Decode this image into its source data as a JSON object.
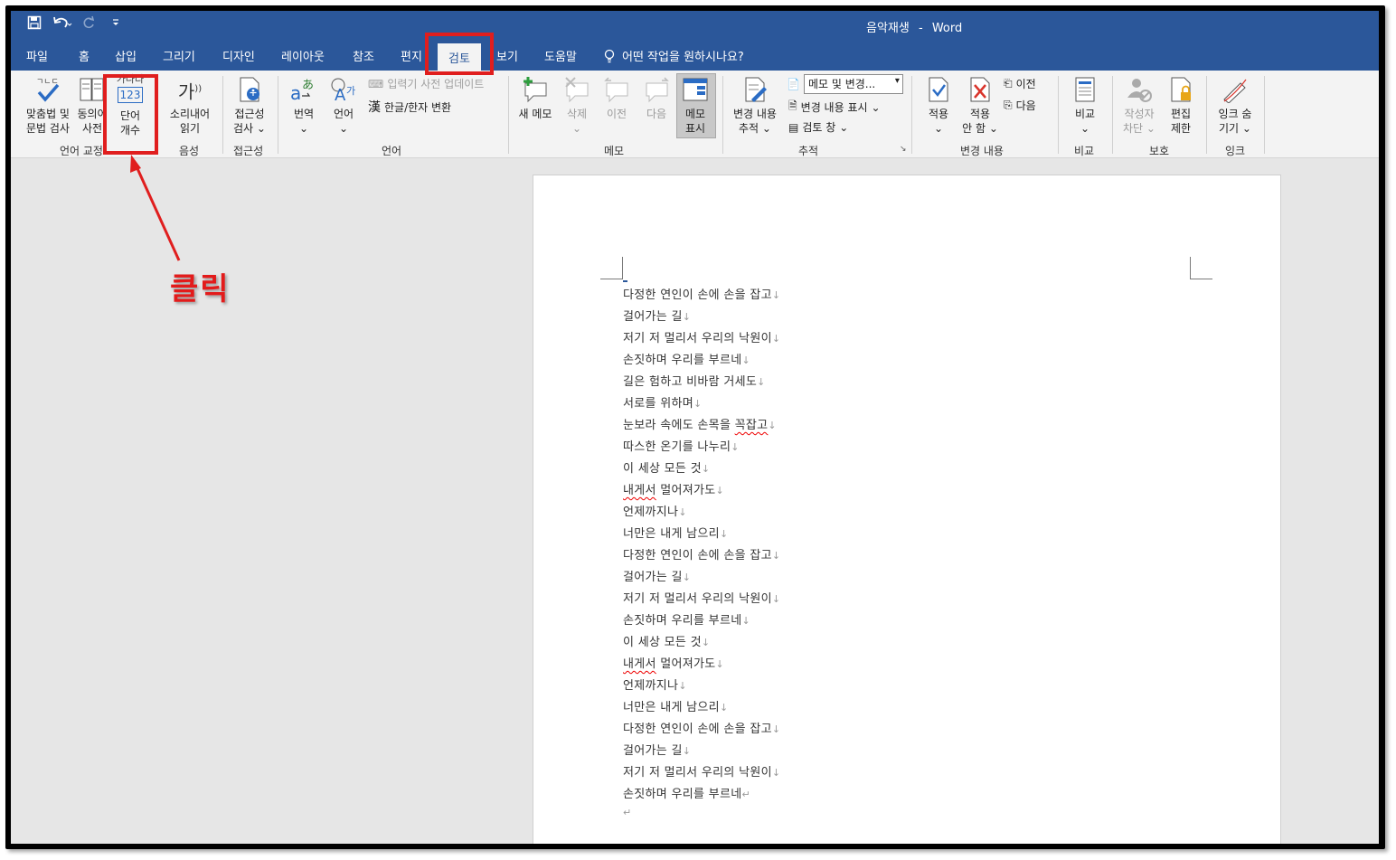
{
  "titlebar": {
    "document_title": "음악재생",
    "separator": "-",
    "app_name": "Word",
    "qat": {
      "save_icon": "save-icon",
      "undo_icon": "undo-icon",
      "redo_icon": "redo-icon",
      "customize_icon": "customize-icon"
    }
  },
  "tabs": [
    {
      "label": "파일"
    },
    {
      "label": "홈"
    },
    {
      "label": "삽입"
    },
    {
      "label": "그리기"
    },
    {
      "label": "디자인"
    },
    {
      "label": "레이아웃"
    },
    {
      "label": "참조"
    },
    {
      "label": "편지"
    },
    {
      "label": "검토",
      "active": true
    },
    {
      "label": "보기"
    },
    {
      "label": "도움말"
    }
  ],
  "tell_me": "어떤 작업을 원하시나요?",
  "ribbon": {
    "proofing": {
      "spelling_l1": "맞춤법 및",
      "spelling_l2": "문법 검사",
      "thesaurus_l1": "동의어",
      "thesaurus_l2": "사전",
      "wordcount_icon_top": "가나다",
      "wordcount_icon_num": "123",
      "wordcount_l1": "단어",
      "wordcount_l2": "개수",
      "group_label": "언어 교정"
    },
    "speech": {
      "read_l1": "소리내어",
      "read_l2": "읽기",
      "read_icon_text": "가",
      "group_label": "음성"
    },
    "accessibility": {
      "check_l1": "접근성",
      "check_l2": "검사",
      "group_label": "접근성"
    },
    "language": {
      "translate": "번역",
      "language": "언어",
      "ime_update": "입력기 사전 업데이트",
      "hanja": "한글/한자 변환",
      "group_label": "언어"
    },
    "comments": {
      "new": "새 메모",
      "delete": "삭제",
      "prev": "이전",
      "next": "다음",
      "show_l1": "메모",
      "show_l2": "표시",
      "group_label": "메모"
    },
    "tracking": {
      "track_l1": "변경 내용",
      "track_l2": "추적",
      "markup_combo": "메모 및 변경...",
      "show_markup": "변경 내용 표시",
      "review_pane": "검토 창",
      "group_label": "추적"
    },
    "changes": {
      "accept_l1": "적용",
      "reject_l1": "적용",
      "reject_l2": "안 함",
      "previous": "이전",
      "next": "다음",
      "group_label": "변경 내용"
    },
    "compare": {
      "compare": "비교",
      "group_label": "비교"
    },
    "protect": {
      "block_l1": "작성자",
      "block_l2": "차단",
      "restrict_l1": "편집",
      "restrict_l2": "제한",
      "group_label": "보호"
    },
    "ink": {
      "hide_l1": "잉크 숨",
      "hide_l2": "기기",
      "group_label": "잉크"
    }
  },
  "annotation": {
    "callout": "클릭"
  },
  "document": {
    "lines": [
      {
        "text": "다정한 연인이 손에 손을 잡고",
        "mark": "↓"
      },
      {
        "text": "걸어가는 길",
        "mark": "↓"
      },
      {
        "text": "저기 저 멀리서 우리의 낙원이",
        "mark": "↓"
      },
      {
        "text": "손짓하며 우리를 부르네",
        "mark": "↓"
      },
      {
        "text": "길은 험하고 비바람 거세도",
        "mark": "↓"
      },
      {
        "text": "서로를 위하며",
        "mark": "↓"
      },
      {
        "pre": "눈보라 속에도 손목을 ",
        "squig": "꼭잡고",
        "post": "",
        "mark": "↓"
      },
      {
        "text": "따스한 온기를 나누리",
        "mark": "↓"
      },
      {
        "text": "이 세상 모든 것",
        "mark": "↓"
      },
      {
        "pre": "",
        "squig": "내게서",
        "post": " 멀어져가도",
        "mark": "↓"
      },
      {
        "text": "언제까지나",
        "mark": "↓"
      },
      {
        "text": "너만은 내게 남으리",
        "mark": "↓"
      },
      {
        "text": "다정한 연인이 손에 손을 잡고",
        "mark": "↓"
      },
      {
        "text": "걸어가는 길",
        "mark": "↓"
      },
      {
        "text": "저기 저 멀리서 우리의 낙원이",
        "mark": "↓"
      },
      {
        "text": "손짓하며 우리를 부르네",
        "mark": "↓"
      },
      {
        "text": "이 세상 모든 것",
        "mark": "↓"
      },
      {
        "pre": "",
        "squig": "내게서",
        "post": " 멀어져가도",
        "mark": "↓"
      },
      {
        "text": "언제까지나",
        "mark": "↓"
      },
      {
        "text": "너만은 내게 남으리",
        "mark": "↓"
      },
      {
        "text": "다정한 연인이 손에 손을 잡고",
        "mark": "↓"
      },
      {
        "text": "걸어가는 길",
        "mark": "↓"
      },
      {
        "text": "저기 저 멀리서 우리의 낙원이",
        "mark": "↓"
      },
      {
        "text": "손짓하며 우리를 부르네",
        "mark": "↵"
      },
      {
        "text": "",
        "mark": "↵"
      }
    ]
  },
  "colors": {
    "accent": "#2b579a",
    "highlight": "#e01e1e"
  }
}
